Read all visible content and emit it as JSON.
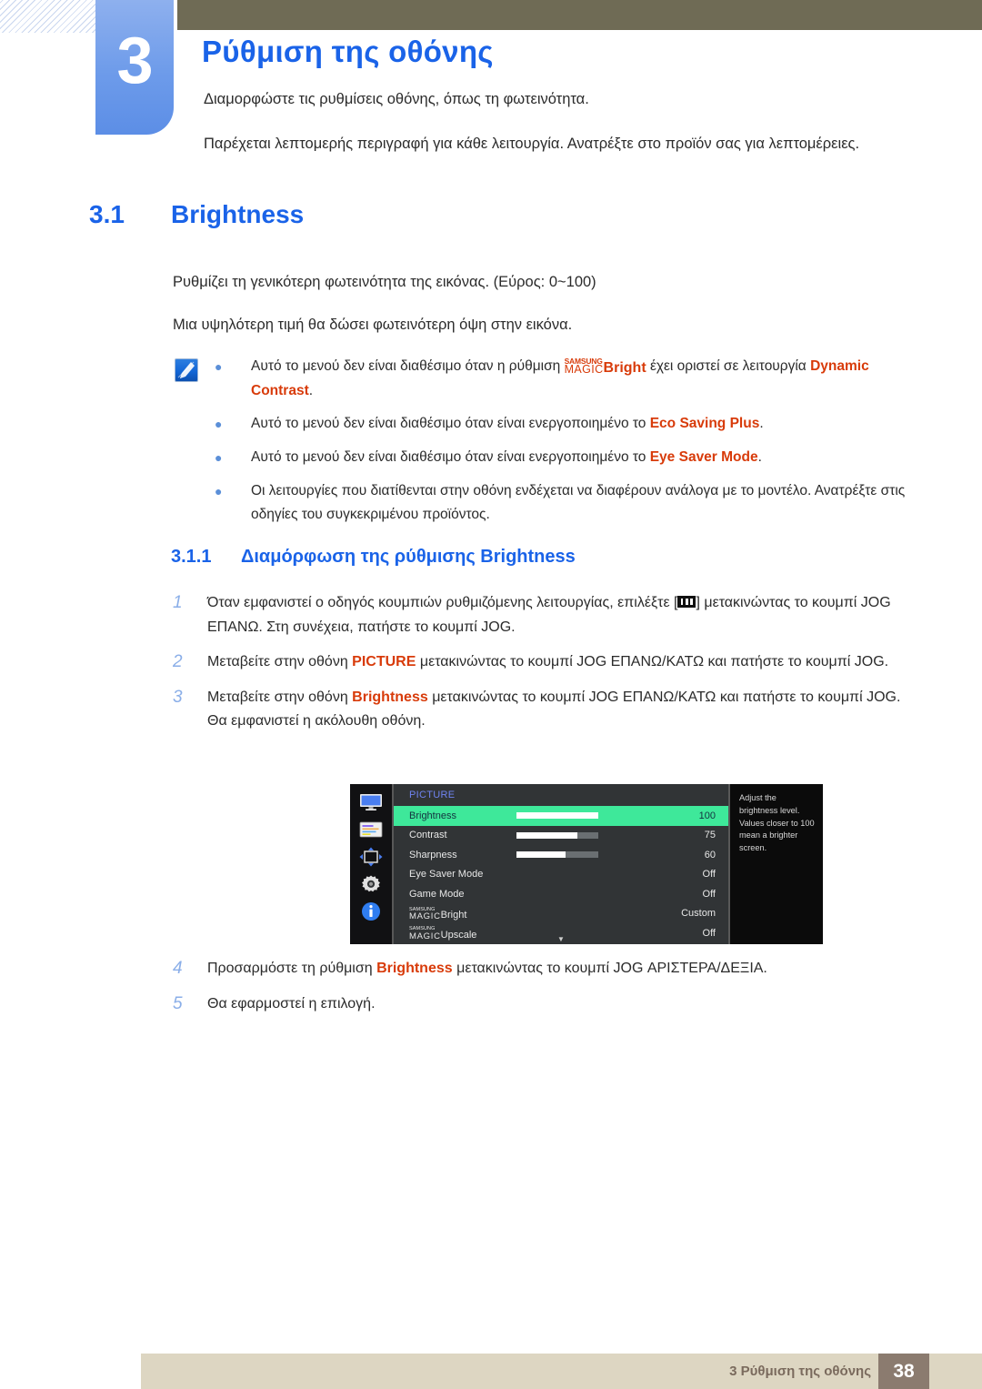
{
  "chapter": {
    "number": "3",
    "title": "Ρύθμιση της οθόνης",
    "intro_1": "Διαμορφώστε τις ρυθμίσεις οθόνης, όπως τη φωτεινότητα.",
    "intro_2": "Παρέχεται λεπτομερής περιγραφή για κάθε λειτουργία. Ανατρέξτε στο προϊόν σας για λεπτομέρειες."
  },
  "section": {
    "number": "3.1",
    "title": "Brightness",
    "para_range": "Ρυθμίζει τη γενικότερη φωτεινότητα της εικόνας. (Εύρος: 0~100)",
    "para_higher": "Μια υψηλότερη τιμή θα δώσει φωτεινότερη όψη στην εικόνα."
  },
  "note": {
    "icon_name": "note-pencil-icon",
    "bullet_char": "●",
    "items": [
      {
        "pre": "Αυτό το μενού δεν είναι διαθέσιμο όταν η ρύθμιση ",
        "logo_top": "SAMSUNG",
        "logo_mid": "MAGIC",
        "logo_suffix": "Bright",
        "mid": " έχει οριστεί σε λειτουργία ",
        "emphasis": "Dynamic Contrast",
        "post": "."
      },
      {
        "pre": "Αυτό το μενού δεν είναι διαθέσιμο όταν είναι ενεργοποιημένο το ",
        "emphasis": "Eco Saving Plus",
        "post": "."
      },
      {
        "pre": "Αυτό το μενού δεν είναι διαθέσιμο όταν είναι ενεργοποιημένο το ",
        "emphasis": "Eye Saver Mode",
        "post": "."
      },
      {
        "pre": "Οι λειτουργίες που διατίθενται στην οθόνη ενδέχεται να διαφέρουν ανάλογα με το μοντέλο. Ανατρέξτε στις οδηγίες του συγκεκριμένου προϊόντος.",
        "emphasis": "",
        "post": ""
      }
    ]
  },
  "subsection": {
    "number": "3.1.1",
    "title": "Διαμόρφωση της ρύθμισης Brightness"
  },
  "steps": [
    {
      "num": "1",
      "pre": "Όταν εμφανιστεί ο οδηγός κουμπιών ρυθμιζόμενης λειτουργίας, επιλέξτε [",
      "glyph": "jog-menu-icon",
      "post": "] μετακινώντας το κουμπί JOG ΕΠΑΝΩ. Στη συνέχεια, πατήστε το κουμπί JOG."
    },
    {
      "num": "2",
      "pre": "Μεταβείτε στην οθόνη ",
      "emphasis": "PICTURE",
      "post": " μετακινώντας το κουμπί JOG ΕΠΑΝΩ/ΚΑΤΩ και πατήστε το κουμπί JOG."
    },
    {
      "num": "3",
      "pre": "Μεταβείτε στην οθόνη ",
      "emphasis": "Brightness",
      "post": " μετακινώντας το κουμπί JOG ΕΠΑΝΩ/ΚΑΤΩ και πατήστε το κουμπί JOG. Θα εμφανιστεί η ακόλουθη οθόνη."
    },
    {
      "num": "4",
      "pre": "Προσαρμόστε τη ρύθμιση ",
      "emphasis": "Brightness",
      "post": " μετακινώντας το κουμπί JOG ΑΡΙΣΤΕΡΑ/ΔΕΞΙΑ."
    },
    {
      "num": "5",
      "pre": "Θα εφαρμοστεί η επιλογή.",
      "emphasis": "",
      "post": ""
    }
  ],
  "osd": {
    "title": "PICTURE",
    "rail_icons": [
      "monitor-icon",
      "onscreen-display-icon",
      "system-arrows-icon",
      "gear-icon",
      "information-icon"
    ],
    "rows": [
      {
        "label": "Brightness",
        "value": "100",
        "slider": 100,
        "selected": true
      },
      {
        "label": "Contrast",
        "value": "75",
        "slider": 75,
        "selected": false
      },
      {
        "label": "Sharpness",
        "value": "60",
        "slider": 60,
        "selected": false
      },
      {
        "label": "Eye Saver Mode",
        "value": "Off",
        "slider": null,
        "selected": false
      },
      {
        "label": "Game Mode",
        "value": "Off",
        "slider": null,
        "selected": false
      }
    ],
    "magic_rows": [
      {
        "logo_top": "SAMSUNG",
        "logo_mid": "MAGIC",
        "logo_suffix": "Bright",
        "value": "Custom"
      },
      {
        "logo_top": "SAMSUNG",
        "logo_mid": "MAGIC",
        "logo_suffix": "Upscale",
        "value": "Off"
      }
    ],
    "scroll_caret": "▼",
    "help_text": "Adjust the brightness level. Values closer to 100 mean a brighter screen."
  },
  "footer": {
    "text": "3 Ρύθμιση της οθόνης",
    "page_number": "38"
  },
  "colors": {
    "accent_blue": "#1a63e8",
    "tab_blue": "#6d9bea",
    "olive": "#6f6b55",
    "red_emphasis": "#d83b0a",
    "osd_highlight": "#3ee89a",
    "footer_bar": "#ddd6c2",
    "footer_box": "#8b7b6f"
  }
}
